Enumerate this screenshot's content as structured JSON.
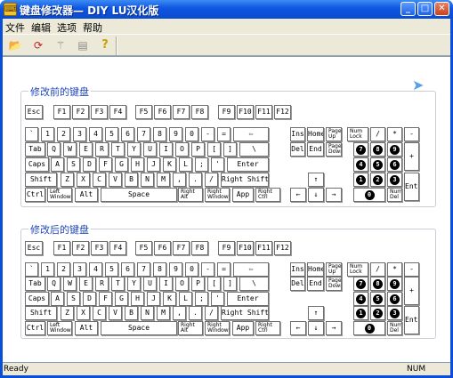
{
  "window": {
    "title": "键盘修改器— DIY   LU汉化版"
  },
  "titlebar_buttons": {
    "minimize": "_",
    "maximize": "□",
    "close": "✕"
  },
  "menu": [
    "文件",
    "编辑",
    "选项",
    "帮助"
  ],
  "toolbar": [
    {
      "name": "open-icon",
      "glyph": "📂"
    },
    {
      "name": "refresh-icon",
      "glyph": "⟳"
    },
    {
      "name": "wand-icon",
      "glyph": "⚚"
    },
    {
      "name": "doc-icon",
      "glyph": "▤"
    },
    {
      "name": "help-icon",
      "glyph": "?"
    }
  ],
  "group_before": {
    "label": "修改前的键盘"
  },
  "group_after": {
    "label": "修改后的键盘"
  },
  "keys": {
    "esc": "Esc",
    "f1": "F1",
    "f2": "F2",
    "f3": "F3",
    "f4": "F4",
    "f5": "F5",
    "f6": "F6",
    "f7": "F7",
    "f8": "F8",
    "f9": "F9",
    "f10": "F10",
    "f11": "F11",
    "f12": "F12",
    "grave": "`",
    "n1": "1",
    "n2": "2",
    "n3": "3",
    "n4": "4",
    "n5": "5",
    "n6": "6",
    "n7": "7",
    "n8": "8",
    "n9": "9",
    "n0": "0",
    "minus": "-",
    "equal": "=",
    "back": "⇦",
    "tab": "Tab",
    "q": "Q",
    "w": "W",
    "e": "E",
    "r": "R",
    "t": "T",
    "y": "Y",
    "u": "U",
    "i": "I",
    "o": "O",
    "p": "P",
    "lbr": "[",
    "rbr": "]",
    "bsl": "\\",
    "caps": "Caps",
    "a": "A",
    "s": "S",
    "d": "D",
    "f": "F",
    "g": "G",
    "h": "H",
    "j": "J",
    "k": "K",
    "l": "L",
    "semi": ";",
    "quote": "'",
    "enter": "Enter",
    "shift": "Shift",
    "z": "Z",
    "x": "X",
    "c": "C",
    "v": "V",
    "b": "B",
    "n": "N",
    "m": "M",
    "comma": ",",
    "dot": ".",
    "slash": "/",
    "rshift": "Right Shift",
    "ctrl": "Ctrl",
    "lwin": "Left Windows",
    "alt": "Alt",
    "space": "Space",
    "ralt": "Right Alt",
    "rwin": "Right Windows",
    "app": "App",
    "rctrl": "Right Ctrl",
    "ins": "Ins",
    "home": "Home",
    "pgup": "Page Up",
    "del": "Del",
    "end": "End",
    "pgdn": "Page Down",
    "up": "↑",
    "left": "←",
    "down": "↓",
    "right": "→",
    "numlock": "Num Lock",
    "ndiv": "/",
    "nmul": "*",
    "nsub": "-",
    "nadd": "+",
    "nenter": "Enter",
    "np7": "7",
    "np8": "8",
    "np9": "9",
    "np4": "4",
    "np5": "5",
    "np6": "6",
    "np1": "1",
    "np2": "2",
    "np3": "3",
    "np0": "0",
    "numdel": "Num Del"
  },
  "status": {
    "text": "Ready",
    "num": "NUM"
  }
}
